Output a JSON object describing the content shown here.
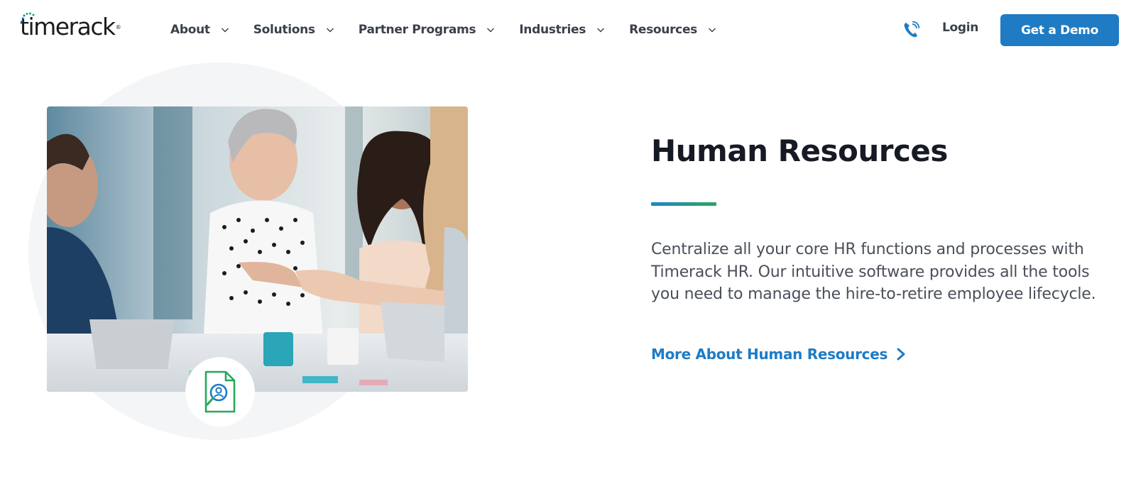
{
  "brand": {
    "logo_text": "timerack",
    "logo_reg": "®"
  },
  "nav": {
    "items": [
      {
        "label": "About"
      },
      {
        "label": "Solutions"
      },
      {
        "label": "Partner Programs"
      },
      {
        "label": "Industries"
      },
      {
        "label": "Resources"
      }
    ]
  },
  "header_actions": {
    "phone_icon": "phone-icon",
    "login_label": "Login",
    "demo_label": "Get a Demo"
  },
  "hero": {
    "title": "Human Resources",
    "description": "Centralize all your core HR functions and processes with Timerack HR. Our intuitive software provides all the tools you need to manage the hire-to-retire employee lifecycle.",
    "link_label": "More About Human Resources",
    "badge_icon": "hr-document-person-icon",
    "photo_alt": "photo-handshake-meeting"
  },
  "colors": {
    "primary_blue": "#1e7bc4",
    "accent_green": "#27a85b",
    "title_color": "#151a24",
    "text_gray": "#4a4f5a"
  }
}
